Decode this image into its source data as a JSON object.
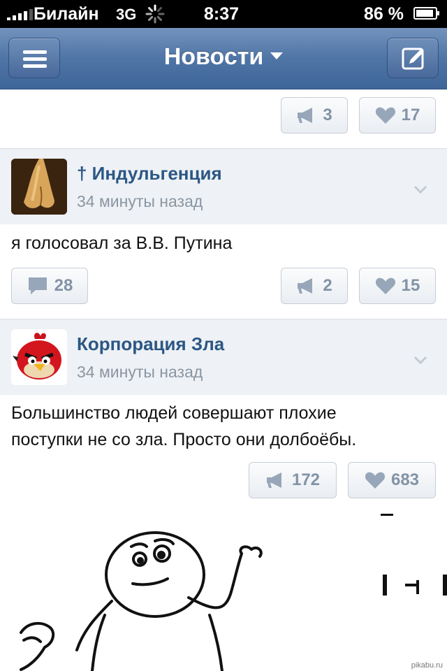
{
  "status_bar": {
    "carrier": "Билайн",
    "network": "3G",
    "time": "8:37",
    "battery": "86 %"
  },
  "nav": {
    "title": "Новости",
    "menu_icon": "hamburger-icon",
    "compose_icon": "compose-icon"
  },
  "top_post_actions": {
    "reposts": "3",
    "likes": "17"
  },
  "posts": [
    {
      "author": "† Индульгенция",
      "time": "34 минуты назад",
      "text": "я голосовал за В.В. Путина",
      "comments": "28",
      "reposts": "2",
      "likes": "15"
    },
    {
      "author": "Корпорация Зла",
      "time": "34 минуты назад",
      "text_lines": [
        "Большинство людей совершают плохие",
        "поступки не со зла. Просто они долбоёбы."
      ],
      "reposts": "172",
      "likes": "683"
    }
  ],
  "watermark": "pikabu.ru",
  "colors": {
    "nav": "#4f75a6",
    "author": "#2b5784",
    "counter": "#8393a7",
    "header_bg": "#eef1f5"
  }
}
